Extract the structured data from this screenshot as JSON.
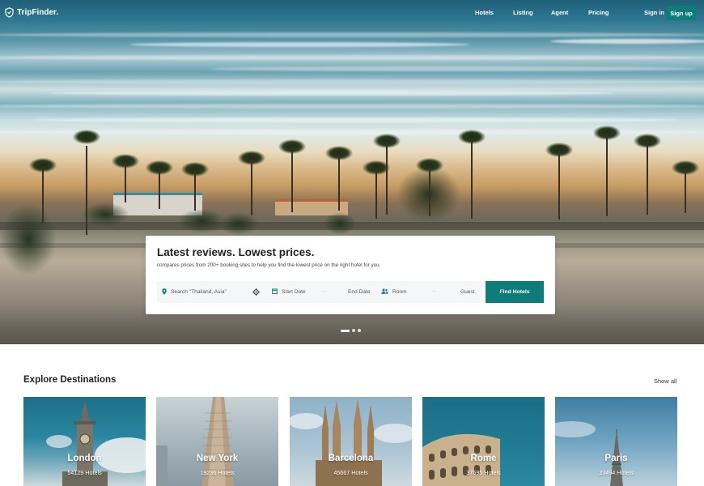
{
  "nav": {
    "logo_text": "TripFinder.",
    "links": [
      "Hotels",
      "Listing",
      "Agent",
      "Pricing"
    ],
    "signin": "Sign in",
    "signup": "Sign up"
  },
  "search": {
    "title": "Latest reviews. Lowest prices.",
    "subtitle": "compares prices from 200+ booking sites to help you find the lowest price on the right hotel for you.",
    "location_placeholder": "Search \"Thailand, Asia\"",
    "start_date": "Start Date",
    "date_sep": "-",
    "end_date": "End Date",
    "room": "Room",
    "guest_sep": "-",
    "guest": "Guest",
    "button": "Find Hotels"
  },
  "explore": {
    "title": "Explore Destinations",
    "show_all": "Show all",
    "destinations": [
      {
        "name": "London",
        "hotels": "54129 Hotels"
      },
      {
        "name": "New York",
        "hotels": "19236 Hotels"
      },
      {
        "name": "Barcelona",
        "hotels": "45667 Hotels"
      },
      {
        "name": "Rome",
        "hotels": "37695 Hotels"
      },
      {
        "name": "Paris",
        "hotels": "23494 Hotels"
      }
    ]
  },
  "colors": {
    "accent": "#0e7c7b"
  },
  "icons": {
    "logo": "shield-icon",
    "location": "map-pin-icon",
    "gps": "crosshair-icon",
    "calendar": "calendar-icon",
    "guests": "users-icon"
  }
}
